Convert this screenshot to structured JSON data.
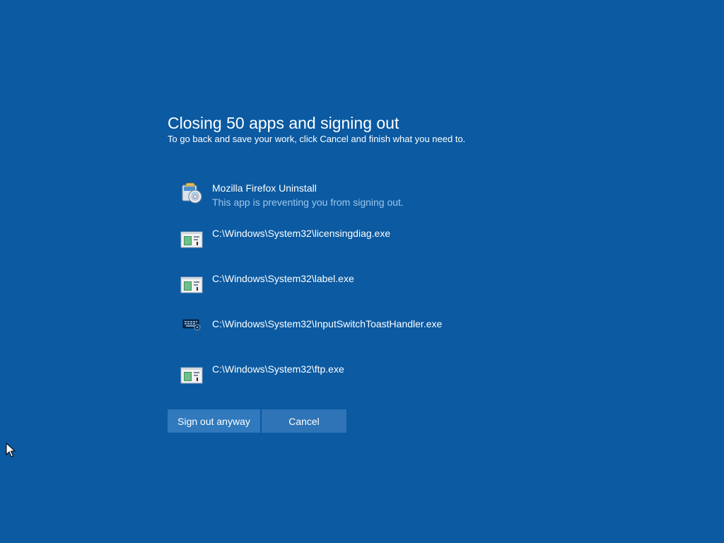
{
  "dialog": {
    "title": "Closing 50 apps and signing out",
    "subtitle": "To go back and save your work, click Cancel and finish what you need to."
  },
  "apps": [
    {
      "name": "Mozilla Firefox Uninstall",
      "status": "This app is preventing you from signing out.",
      "icon": "installer-icon"
    },
    {
      "name": "C:\\Windows\\System32\\licensingdiag.exe",
      "status": "",
      "icon": "console-window-icon"
    },
    {
      "name": "C:\\Windows\\System32\\label.exe",
      "status": "",
      "icon": "console-window-icon"
    },
    {
      "name": "C:\\Windows\\System32\\InputSwitchToastHandler.exe",
      "status": "",
      "icon": "keyboard-settings-icon"
    },
    {
      "name": "C:\\Windows\\System32\\ftp.exe",
      "status": "",
      "icon": "console-window-icon"
    }
  ],
  "buttons": {
    "sign_out_label": "Sign out anyway",
    "cancel_label": "Cancel"
  },
  "colors": {
    "background": "#0b5aa2",
    "button": "#2f79bc",
    "status_text": "#9ec7ec"
  }
}
